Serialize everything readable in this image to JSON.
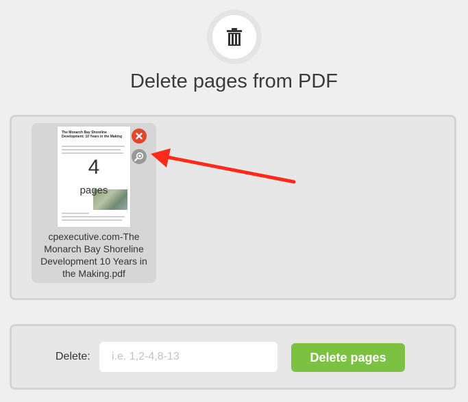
{
  "header": {
    "title": "Delete pages from PDF",
    "icon": "trash-icon"
  },
  "file": {
    "thumbnail_title": "The Monarch Bay Shoreline Development: 10 Years in the Making",
    "page_count": "4",
    "page_unit": "pages",
    "name": "cpexecutive.com-The Monarch Bay Shoreline Development 10 Years in the Making.pdf",
    "remove_icon": "close-icon",
    "zoom_icon": "zoom-in-icon"
  },
  "delete_form": {
    "label": "Delete:",
    "placeholder": "i.e. 1,2-4,8-13",
    "value": "",
    "button_label": "Delete pages"
  },
  "colors": {
    "background": "#efefef",
    "panel": "#e7e7e7",
    "panel_border": "#d4d4d4",
    "remove": "#e3452d",
    "zoom": "#999999",
    "accent_green": "#7cc242",
    "annotation_arrow": "#ff2a1a"
  }
}
